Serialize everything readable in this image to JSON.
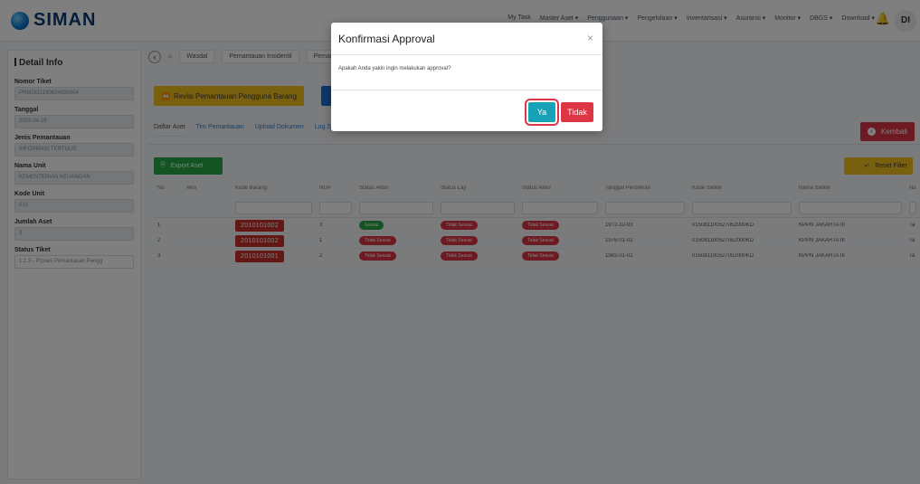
{
  "brand": {
    "name": "SIMAN"
  },
  "topnav": {
    "items": [
      "My Task",
      "Master Aset ▾",
      "Penggunaan ▾",
      "Pengelolaan ▾",
      "Inventarisasi ▾",
      "Asuransi ▾",
      "Monitor ▾",
      "DBGS ▾",
      "Download ▾"
    ],
    "avatar_initials": "DI"
  },
  "sidebar": {
    "title": "Detail Info",
    "fields": [
      {
        "label": "Nomor Tiket",
        "value": "PRM2611190634080004"
      },
      {
        "label": "Tanggal",
        "value": "2023-04-19"
      },
      {
        "label": "Jenis Pemantauan",
        "value": "INFORMASI TERTULIS"
      },
      {
        "label": "Nama Unit",
        "value": "KEMENTERIAN KEUANGAN"
      },
      {
        "label": "Kode Unit",
        "value": "015"
      },
      {
        "label": "Jumlah Aset",
        "value": "3"
      },
      {
        "label": "Status Tiket",
        "value": "1.1.3 - Proses Pemantauan Pengg"
      }
    ]
  },
  "breadcrumb": {
    "items": [
      "Wasdal",
      "Pemantauan Insidentil",
      "Pemar"
    ]
  },
  "buttons": {
    "revisi": "Revisi Pemantauan Pengguna Barang",
    "kembali": "Kembali",
    "export": "Export Aset",
    "reset": "Reset Filter"
  },
  "tabs": [
    "Daftar Aset",
    "Tim Pemantauan",
    "Upload Dokumen",
    "Log Status"
  ],
  "table": {
    "headers": [
      "No",
      "Aksi",
      "Kode Barang",
      "NUP",
      "Status Aktor",
      "Status Lay",
      "Status Aktor",
      "Tanggal Perolehan",
      "Kode Satker",
      "Nama Satker",
      "Nu"
    ],
    "rows": [
      {
        "no": "1",
        "kode": "2010101002",
        "nup": "3",
        "status1": "Sesuai",
        "status1_color": "green",
        "status2": "Tidak Sesuai",
        "status3": "Tidak Sesuai",
        "tanggal": "1972-12-03",
        "kode_satker": "015081100527052000KD",
        "nama_satker": "KPPN JAKARTA III",
        "nu": "Ta"
      },
      {
        "no": "2",
        "kode": "2010101002",
        "nup": "1",
        "status1": "Tidak Sesuai",
        "status1_color": "red",
        "status2": "Tidak Sesuai",
        "status3": "Tidak Sesuai",
        "tanggal": "1976-01-02",
        "kode_satker": "015081100527052000KD",
        "nama_satker": "KPPN JAKARTA III",
        "nu": "Ta"
      },
      {
        "no": "3",
        "kode": "2010101001",
        "nup": "2",
        "status1": "Tidak Sesuai",
        "status1_color": "red",
        "status2": "Tidak Sesuai",
        "status3": "Tidak Sesuai",
        "tanggal": "1982-01-02",
        "kode_satker": "015081100527052000KD",
        "nama_satker": "KPPN JAKARTA III",
        "nu": "Ta"
      }
    ]
  },
  "modal": {
    "title": "Konfirmasi Approval",
    "close": "×",
    "message": "Apakah Anda yakin ingin melakukan approval?",
    "yes": "Ya",
    "no": "Tidak"
  },
  "colors": {
    "accent_blue": "#1a6fd6",
    "danger": "#dc3545",
    "warning": "#f3c11c",
    "success": "#28a745",
    "info": "#17a2b8",
    "brand": "#0b3b73"
  }
}
